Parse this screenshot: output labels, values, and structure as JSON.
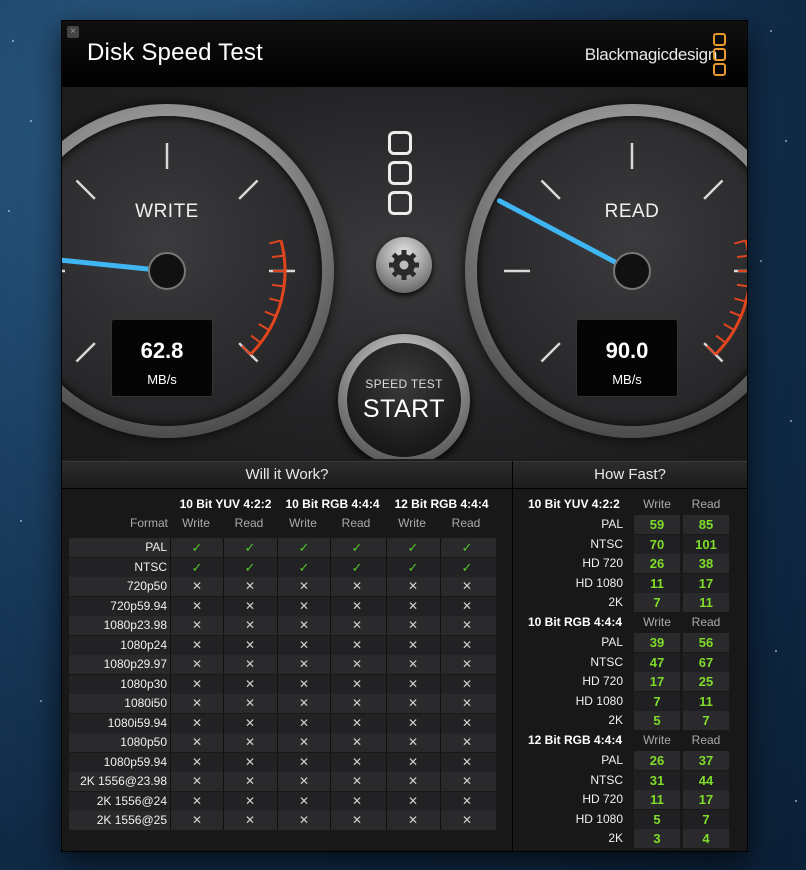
{
  "app": {
    "title": "Disk Speed Test",
    "brand": "Blackmagicdesign",
    "close_glyph": "×",
    "accent_color": "#e89a2c",
    "needle_color": "#3fb6f2"
  },
  "gauges": {
    "write": {
      "label": "WRITE",
      "value": "62.8",
      "unit": "MB/s"
    },
    "read": {
      "label": "READ",
      "value": "90.0",
      "unit": "MB/s"
    }
  },
  "start_button": {
    "subtitle": "SPEED TEST",
    "label": "START"
  },
  "will_it_work": {
    "heading": "Will it Work?",
    "format_label": "Format",
    "groups": [
      "10 Bit YUV 4:2:2",
      "10 Bit RGB 4:4:4",
      "12 Bit RGB 4:4:4"
    ],
    "subheaders": [
      "Write",
      "Read",
      "Write",
      "Read",
      "Write",
      "Read"
    ],
    "rows": [
      {
        "format": "PAL",
        "cells": [
          "✓",
          "✓",
          "✓",
          "✓",
          "✓",
          "✓"
        ]
      },
      {
        "format": "NTSC",
        "cells": [
          "✓",
          "✓",
          "✓",
          "✓",
          "✓",
          "✓"
        ]
      },
      {
        "format": "720p50",
        "cells": [
          "✕",
          "✕",
          "✕",
          "✕",
          "✕",
          "✕"
        ]
      },
      {
        "format": "720p59.94",
        "cells": [
          "✕",
          "✕",
          "✕",
          "✕",
          "✕",
          "✕"
        ]
      },
      {
        "format": "1080p23.98",
        "cells": [
          "✕",
          "✕",
          "✕",
          "✕",
          "✕",
          "✕"
        ]
      },
      {
        "format": "1080p24",
        "cells": [
          "✕",
          "✕",
          "✕",
          "✕",
          "✕",
          "✕"
        ]
      },
      {
        "format": "1080p29.97",
        "cells": [
          "✕",
          "✕",
          "✕",
          "✕",
          "✕",
          "✕"
        ]
      },
      {
        "format": "1080p30",
        "cells": [
          "✕",
          "✕",
          "✕",
          "✕",
          "✕",
          "✕"
        ]
      },
      {
        "format": "1080i50",
        "cells": [
          "✕",
          "✕",
          "✕",
          "✕",
          "✕",
          "✕"
        ]
      },
      {
        "format": "1080i59.94",
        "cells": [
          "✕",
          "✕",
          "✕",
          "✕",
          "✕",
          "✕"
        ]
      },
      {
        "format": "1080p50",
        "cells": [
          "✕",
          "✕",
          "✕",
          "✕",
          "✕",
          "✕"
        ]
      },
      {
        "format": "1080p59.94",
        "cells": [
          "✕",
          "✕",
          "✕",
          "✕",
          "✕",
          "✕"
        ]
      },
      {
        "format": "2K 1556@23.98",
        "cells": [
          "✕",
          "✕",
          "✕",
          "✕",
          "✕",
          "✕"
        ]
      },
      {
        "format": "2K 1556@24",
        "cells": [
          "✕",
          "✕",
          "✕",
          "✕",
          "✕",
          "✕"
        ]
      },
      {
        "format": "2K 1556@25",
        "cells": [
          "✕",
          "✕",
          "✕",
          "✕",
          "✕",
          "✕"
        ]
      }
    ]
  },
  "how_fast": {
    "heading": "How Fast?",
    "write_label": "Write",
    "read_label": "Read",
    "groups": [
      {
        "title": "10 Bit YUV 4:2:2",
        "rows": [
          {
            "format": "PAL",
            "write": "59",
            "read": "85"
          },
          {
            "format": "NTSC",
            "write": "70",
            "read": "101"
          },
          {
            "format": "HD 720",
            "write": "26",
            "read": "38"
          },
          {
            "format": "HD 1080",
            "write": "11",
            "read": "17"
          },
          {
            "format": "2K",
            "write": "7",
            "read": "11"
          }
        ]
      },
      {
        "title": "10 Bit RGB 4:4:4",
        "rows": [
          {
            "format": "PAL",
            "write": "39",
            "read": "56"
          },
          {
            "format": "NTSC",
            "write": "47",
            "read": "67"
          },
          {
            "format": "HD 720",
            "write": "17",
            "read": "25"
          },
          {
            "format": "HD 1080",
            "write": "7",
            "read": "11"
          },
          {
            "format": "2K",
            "write": "5",
            "read": "7"
          }
        ]
      },
      {
        "title": "12 Bit RGB 4:4:4",
        "rows": [
          {
            "format": "PAL",
            "write": "26",
            "read": "37"
          },
          {
            "format": "NTSC",
            "write": "31",
            "read": "44"
          },
          {
            "format": "HD 720",
            "write": "11",
            "read": "17"
          },
          {
            "format": "HD 1080",
            "write": "5",
            "read": "7"
          },
          {
            "format": "2K",
            "write": "3",
            "read": "4"
          }
        ]
      }
    ]
  }
}
